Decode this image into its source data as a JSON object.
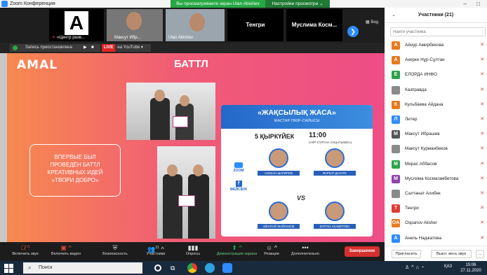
{
  "window": {
    "title": "Zoom Конференция",
    "share_banner": "Вы просматриваете экран Ulan Abishev",
    "view_settings": "Настройки просмотра ⌄",
    "controls": "– □"
  },
  "video_strip": {
    "tiles": [
      {
        "name": "«Центр разв...",
        "muted": true
      },
      {
        "name": "Максут Ибр...",
        "muted": true
      },
      {
        "name": "Ulan Abishev",
        "muted": false
      },
      {
        "name": "Тенгри",
        "muted": false
      },
      {
        "name": "Муслима Косм...",
        "muted": false
      }
    ],
    "view_label": "Вид"
  },
  "recording": {
    "status": "Запись приостановлена",
    "live_label": "LIVE",
    "live_target": "на YouTube ▾"
  },
  "shared_content": {
    "logo": "AMAL",
    "title": "БАТТЛ",
    "left_text_lines": [
      "ВПЕРВЫЕ БЫЛ",
      "ПРОВЕДЁН БАТТЛ",
      "КРЕАТИВНЫХ ИДЕЙ",
      "«ТВОРИ ДОБРО»"
    ],
    "poster": {
      "title": "«ЖАҚСЫЛЫҚ ЖАСА»",
      "subtitle": "ЖАСТАР ПІКІР-САЙЫСЫ",
      "date": "5 ҚЫРКҮЙЕК",
      "time": "11:00",
      "timezone": "(НҰР-СҰЛТАН УАҚЫТЫМЕН)",
      "speakers": [
        "АЛИХАН ШАРИПОВ",
        "ФАРХАТ ДАНАТЕ",
        "АЙНАТАЙ ЖАЙЛАНОВ",
        "КАРГАН АХАМЕТОВА"
      ],
      "platforms": [
        "ZOOM",
        "ФЕЙСБУК"
      ],
      "vs": "VS"
    }
  },
  "toolbar": {
    "items": [
      {
        "label": "Включить звук",
        "icon": "mic-off-icon"
      },
      {
        "label": "Включить видео",
        "icon": "video-off-icon"
      },
      {
        "label": "Безопасность",
        "icon": "shield-icon"
      },
      {
        "label": "Участники",
        "icon": "participants-icon",
        "count": "21"
      },
      {
        "label": "Опросы",
        "icon": "polls-icon"
      },
      {
        "label": "Демонстрация экрана",
        "icon": "share-screen-icon"
      },
      {
        "label": "Реакции",
        "icon": "reactions-icon"
      },
      {
        "label": "Дополнительно",
        "icon": "more-icon"
      }
    ],
    "end_label": "Завершение"
  },
  "participants": {
    "title": "Участники (21)",
    "search_placeholder": "Найти участника",
    "list": [
      {
        "name": "Айнур Амирбекова",
        "initial": "А",
        "color": "#e8791f"
      },
      {
        "name": "Акерке Нұр-Сұлтан",
        "initial": "А",
        "color": "#e8791f"
      },
      {
        "name": "ЕЛОРДА ИНФО",
        "initial": "Е",
        "color": "#2ba34b"
      },
      {
        "name": "Казправда",
        "initial": "",
        "color": "#8a8a8a"
      },
      {
        "name": "Кульбаева Айдана",
        "initial": "К",
        "color": "#e8791f"
      },
      {
        "name": "Литер",
        "initial": "Л",
        "color": "#2d8cff"
      },
      {
        "name": "Максут Ибрашев",
        "initial": "М",
        "color": "#555555"
      },
      {
        "name": "Максут Курманбеков",
        "initial": "",
        "color": "#8a8a8a"
      },
      {
        "name": "Мирас Аббасов",
        "initial": "М",
        "color": "#2ba34b"
      },
      {
        "name": "Муслима Космагамбетова",
        "initial": "М",
        "color": "#8e44ad"
      },
      {
        "name": "Салтанат Алибек",
        "initial": "",
        "color": "#8a8a8a"
      },
      {
        "name": "Тенгри",
        "initial": "Т",
        "color": "#e03c31"
      },
      {
        "name": "Ospanov Alisher",
        "initial": "OA",
        "color": "#e8791f"
      },
      {
        "name": "Анель Наджатова",
        "initial": "А",
        "color": "#2d8cff"
      }
    ],
    "invite_label": "Пригласить",
    "mute_all_label": "Выкл. весь звук",
    "more_label": "..."
  },
  "taskbar": {
    "search_placeholder": "Поиск",
    "lang": "ҚАЗ",
    "time": "15:06",
    "date": "27.11.2020"
  }
}
